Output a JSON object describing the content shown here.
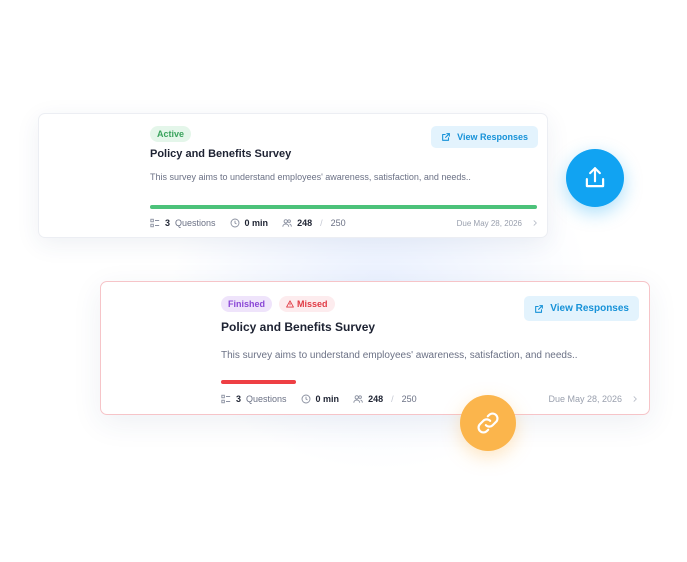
{
  "cards": [
    {
      "status": "Active",
      "title": "Policy and Benefits Survey",
      "description": "This survey aims to understand employees' awareness, satisfaction, and needs..",
      "view_label": "View Responses",
      "questions_count": "3",
      "questions_label": "Questions",
      "duration": "0 min",
      "responses": "248",
      "responses_total": "250",
      "due": "Due May 28, 2026",
      "progress": 1.0,
      "progress_color": "#4cc27a"
    },
    {
      "status": "Finished",
      "status_secondary": "Missed",
      "title": "Policy and Benefits Survey",
      "description": "This survey aims to understand employees' awareness, satisfaction, and needs..",
      "view_label": "View Responses",
      "questions_count": "3",
      "questions_label": "Questions",
      "duration": "0 min",
      "responses": "248",
      "responses_total": "250",
      "due": "Due May 28, 2026",
      "progress": 0.18,
      "progress_color": "#ee3f44"
    }
  ],
  "actions": {
    "share_icon": "share-upload-icon",
    "share_color": "#11a3f2",
    "link_icon": "link-icon",
    "link_color": "#fbb54c"
  }
}
